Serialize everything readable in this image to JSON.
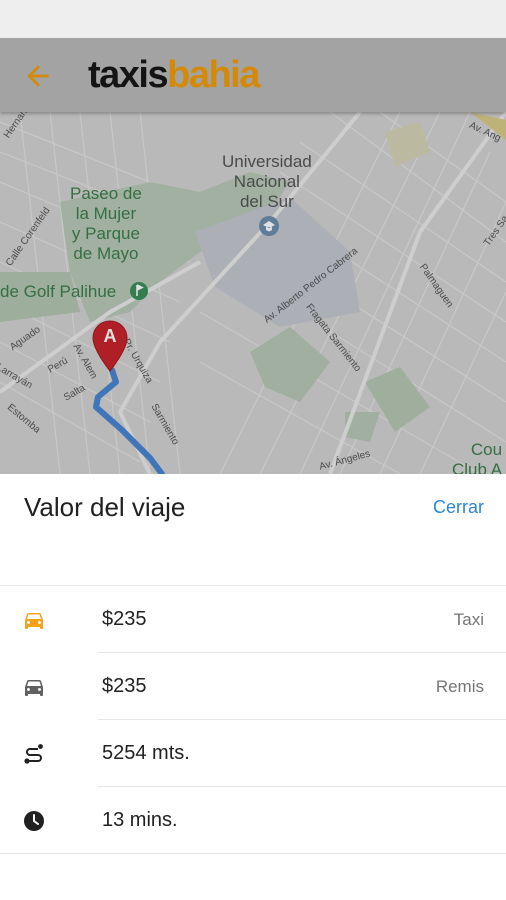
{
  "app": {
    "logo_part1": "taxis",
    "logo_part2": "bahia",
    "back_icon": "arrow-back-icon",
    "brand_color": "#d48a06"
  },
  "map": {
    "places": {
      "university": "Universidad\nNacional\ndel Sur",
      "park": "Paseo de\nla Mujer\ny Parque\nde Mayo",
      "golf": "de Golf Palihue",
      "club": "Cou\nClub A"
    },
    "streets": {
      "s1": "Hernandez",
      "s2": "Calle Corenfeld",
      "s3": "Aguado",
      "s4": "Larrayán",
      "s5": "Perú",
      "s6": "Salta",
      "s7": "Estomba",
      "s8": "Av. Alem",
      "s9": "Pr. Urquiza",
      "s10": "Sarmiento",
      "s11": "Av. Alberto Pedro Cabrera",
      "s12": "Fragata Sarmiento",
      "s13": "Palmaguen",
      "s14": "Tres Sa",
      "s15": "Av. Ang",
      "s16": "Av. Ángeles"
    },
    "marker_label": "A",
    "route_color": "#4a86d4",
    "marker_color": "#c9242b"
  },
  "sheet": {
    "title": "Valor del viaje",
    "close_label": "Cerrar",
    "rows": [
      {
        "icon": "taxi-car-icon",
        "value": "$235",
        "label": "Taxi",
        "icon_color": "#f4a21c"
      },
      {
        "icon": "car-icon",
        "value": "$235",
        "label": "Remis",
        "icon_color": "#616161"
      },
      {
        "icon": "route-icon",
        "value": "5254 mts.",
        "label": ""
      },
      {
        "icon": "clock-icon",
        "value": "13 mins.",
        "label": ""
      }
    ]
  }
}
